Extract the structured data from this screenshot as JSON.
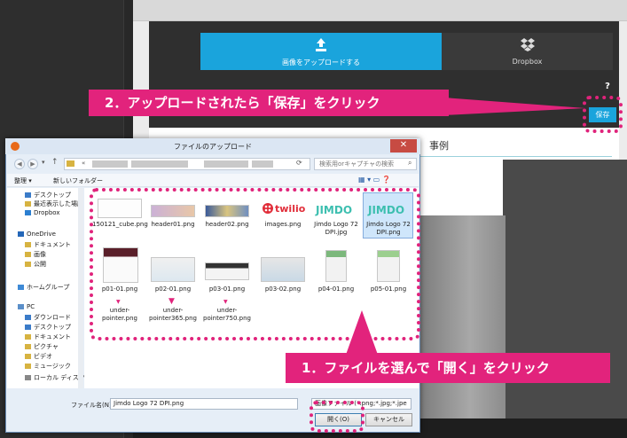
{
  "web": {
    "upload_label": "画像をアップロードする",
    "dropbox_label": "Dropbox",
    "help": "?",
    "save_label": "保存",
    "section_heading": "事例"
  },
  "dialog": {
    "title": "ファイルのアップロード",
    "close": "✕",
    "address_prefix": "«",
    "search_placeholder": "検索用orキャプチャの検索",
    "toolbar": {
      "organize": "整理 ▾",
      "new_folder": "新しいフォルダー"
    },
    "sidebar": [
      "デスクトップ",
      "最近表示した場所",
      "Dropbox",
      "OneDrive",
      "ドキュメント",
      "画像",
      "公開",
      "ホームグループ",
      "PC",
      "ダウンロード",
      "デスクトップ",
      "ドキュメント",
      "ピクチャ",
      "ビデオ",
      "ミュージック",
      "ローカル ディスク (C"
    ],
    "files": [
      {
        "name": "150121_cube.png"
      },
      {
        "name": "header01.png"
      },
      {
        "name": "header02.png"
      },
      {
        "name": "images.png"
      },
      {
        "name": "Jimdo Logo 72 DPI.jpg"
      },
      {
        "name": "Jimdo Logo 72 DPI.png"
      },
      {
        "name": "p01-01.png"
      },
      {
        "name": "p02-01.png"
      },
      {
        "name": "p03-01.png"
      },
      {
        "name": "p03-02.png"
      },
      {
        "name": "p04-01.png"
      },
      {
        "name": "p05-01.png"
      },
      {
        "name": "under-pointer.png"
      },
      {
        "name": "under-pointer365.png"
      },
      {
        "name": "under-pointer750.png"
      }
    ],
    "filename_label": "ファイル名(N):",
    "filename_value": "Jimdo Logo 72 DPI.png",
    "filetype_value": "画像ファイル (*.png;*.jpg;*.jpe",
    "open_label": "開く(O)",
    "cancel_label": "キャンセル"
  },
  "annotations": {
    "step2": "2．アップロードされたら「保存」をクリック",
    "step1": "1．ファイルを選んで「開く」をクリック"
  },
  "colors": {
    "accent": "#1aa4dc",
    "callout": "#e2237c"
  }
}
